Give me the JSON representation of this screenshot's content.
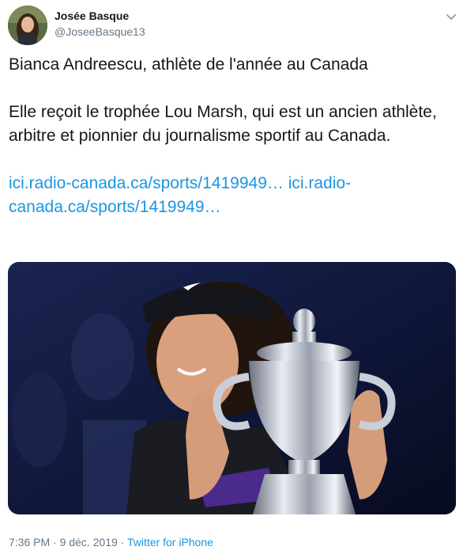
{
  "author": {
    "name": "Josée Basque",
    "handle": "@JoseeBasque13"
  },
  "tweet": {
    "line1": "Bianca Andreescu, athlète de l'année au Canada",
    "line2": "Elle reçoit le trophée Lou Marsh, qui est un ancien athlète, arbitre et pionnier du journalisme sportif au Canada.",
    "link1": "ici.radio-canada.ca/sports/1419949…",
    "link2": "ici.radio-canada.ca/sports/1419949…"
  },
  "meta": {
    "time": "7:36 PM",
    "separator1": "·",
    "date": "9 déc. 2019",
    "separator2": "·",
    "source": "Twitter for iPhone"
  },
  "colors": {
    "link": "#1b95e0",
    "secondary": "#657786",
    "text": "#14171a"
  },
  "icons": {
    "caret": "chevron-down-icon"
  }
}
